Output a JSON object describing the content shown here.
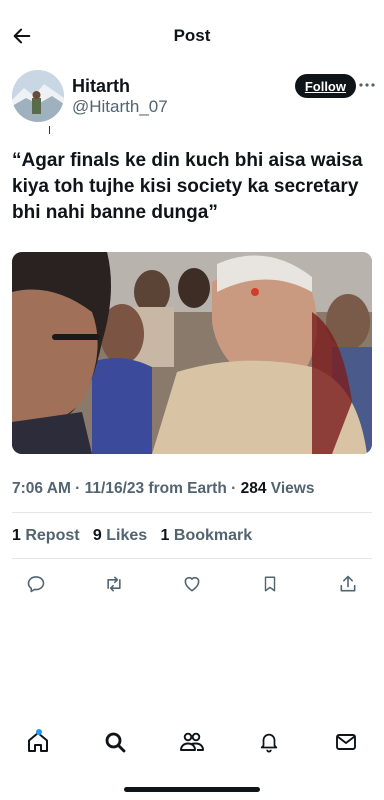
{
  "header": {
    "title": "Post",
    "back_icon": "arrow-left-icon"
  },
  "author": {
    "display_name": "Hitarth",
    "handle": "@Hitarth_07",
    "follow_label": "Follow",
    "avatar_icon": "profile-photo"
  },
  "post": {
    "text": "“Agar finals ke din kuch bhi aisa waisa kiya toh tujhe kisi society ka secretary bhi nahi banne dunga”",
    "media_description_icon": "photo"
  },
  "meta": {
    "time": "7:06 AM",
    "sep1": " · ",
    "date": "11/16/23",
    "source": " from Earth",
    "sep2": " · ",
    "views_count": "284",
    "views_label": " Views"
  },
  "stats": {
    "reposts_count": "1",
    "reposts_label": " Repost",
    "likes_count": "9",
    "likes_label": " Likes",
    "bookmarks_count": "1",
    "bookmarks_label": " Bookmark"
  },
  "actions": [
    "reply-icon",
    "repost-icon",
    "like-icon",
    "bookmark-icon",
    "share-icon"
  ],
  "tabbar": [
    "home-icon",
    "search-icon",
    "communities-icon",
    "notifications-icon",
    "messages-icon"
  ],
  "colors": {
    "text": "#0f1419",
    "secondary": "#536471",
    "accent": "#1d9bf0",
    "divider": "#e4e7ea"
  }
}
